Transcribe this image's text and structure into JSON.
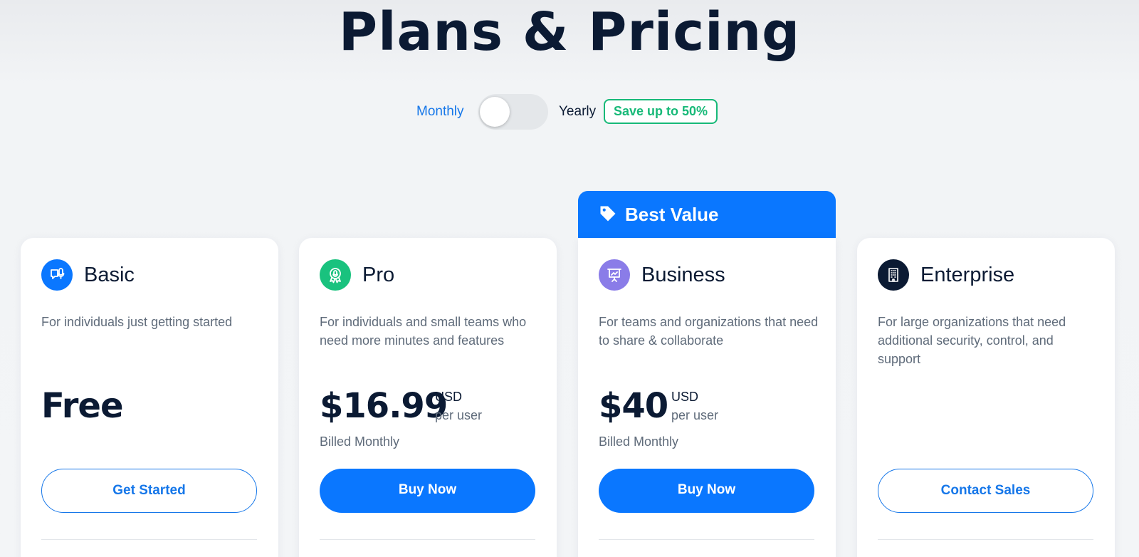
{
  "page": {
    "title": "Plans & Pricing"
  },
  "billing_toggle": {
    "monthly_label": "Monthly",
    "yearly_label": "Yearly",
    "selected": "Monthly",
    "save_badge": "Save up to 50%"
  },
  "colors": {
    "accent": "#0a77ff",
    "save_green": "#17b978",
    "title": "#0b1a33",
    "muted_text": "#5f6b7a"
  },
  "plans": [
    {
      "name": "Basic",
      "icon": "chat-mic-icon",
      "icon_color": "#0a77ff",
      "description": "For individuals just getting started",
      "price": "Free",
      "currency": "",
      "per": "",
      "billed": "",
      "cta": "Get Started",
      "cta_style": "outline"
    },
    {
      "name": "Pro",
      "icon": "badge-mic-icon",
      "icon_color": "#19c27e",
      "description": "For individuals and small teams who need more minutes and features",
      "price": "$16.99",
      "currency": "USD",
      "per": "per user",
      "billed": "Billed Monthly",
      "cta": "Buy Now",
      "cta_style": "solid"
    },
    {
      "name": "Business",
      "icon": "presentation-chart-icon",
      "icon_color": "#8a7ce8",
      "description": "For teams and organizations that need to share & collaborate",
      "price": "$40",
      "currency": "USD",
      "per": "per user",
      "billed": "Billed Monthly",
      "cta": "Buy Now",
      "cta_style": "solid",
      "ribbon": "Best Value",
      "ribbon_icon": "tag-icon"
    },
    {
      "name": "Enterprise",
      "icon": "building-icon",
      "icon_color": "#0b1a33",
      "description": "For large organizations that need additional security, control, and support",
      "price": "",
      "currency": "",
      "per": "",
      "billed": "",
      "cta": "Contact Sales",
      "cta_style": "outline"
    }
  ]
}
